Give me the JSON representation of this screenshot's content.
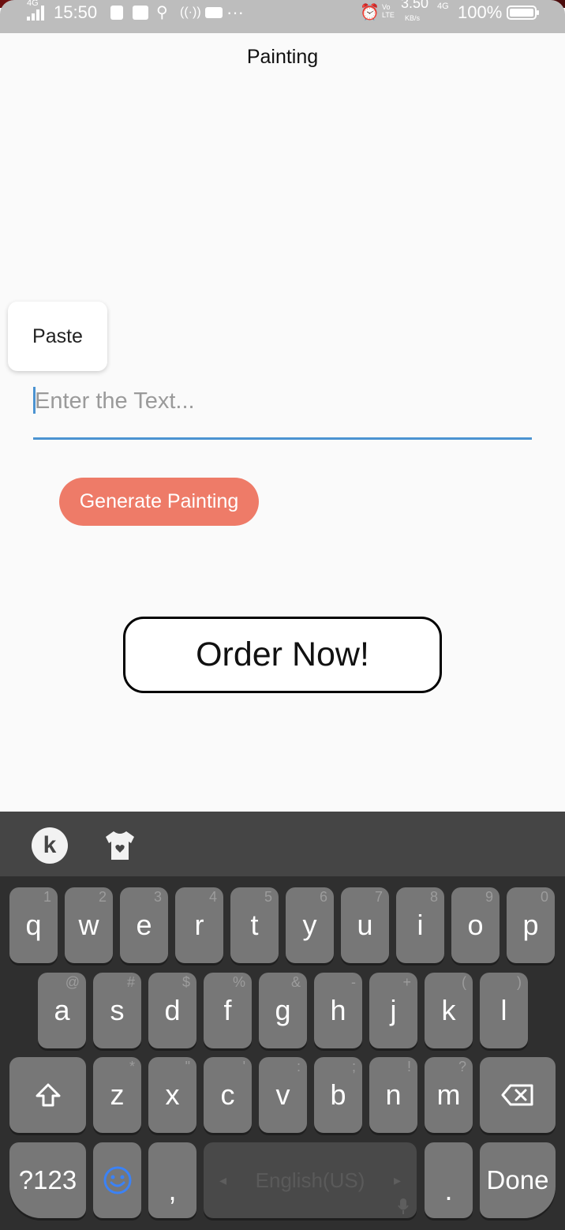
{
  "status_bar": {
    "network": "4G",
    "time": "15:50",
    "speed": "3.50",
    "speed_unit": "KB/s",
    "network2": "4G",
    "battery": "100%",
    "more": "···"
  },
  "app": {
    "title": "Painting"
  },
  "context_menu": {
    "paste_label": "Paste"
  },
  "input": {
    "placeholder": "Enter the Text...",
    "value": ""
  },
  "buttons": {
    "generate": "Generate Painting",
    "order": "Order Now!"
  },
  "keyboard": {
    "logo": "k",
    "row1": [
      {
        "label": "q",
        "hint": "1"
      },
      {
        "label": "w",
        "hint": "2"
      },
      {
        "label": "e",
        "hint": "3"
      },
      {
        "label": "r",
        "hint": "4"
      },
      {
        "label": "t",
        "hint": "5"
      },
      {
        "label": "y",
        "hint": "6"
      },
      {
        "label": "u",
        "hint": "7"
      },
      {
        "label": "i",
        "hint": "8"
      },
      {
        "label": "o",
        "hint": "9"
      },
      {
        "label": "p",
        "hint": "0"
      }
    ],
    "row2": [
      {
        "label": "a",
        "hint": "@"
      },
      {
        "label": "s",
        "hint": "#"
      },
      {
        "label": "d",
        "hint": "$"
      },
      {
        "label": "f",
        "hint": "%"
      },
      {
        "label": "g",
        "hint": "&"
      },
      {
        "label": "h",
        "hint": "-"
      },
      {
        "label": "j",
        "hint": "+"
      },
      {
        "label": "k",
        "hint": "("
      },
      {
        "label": "l",
        "hint": ")"
      }
    ],
    "row3": [
      {
        "label": "z",
        "hint": "*"
      },
      {
        "label": "x",
        "hint": "\""
      },
      {
        "label": "c",
        "hint": "'"
      },
      {
        "label": "v",
        "hint": ":"
      },
      {
        "label": "b",
        "hint": ";"
      },
      {
        "label": "n",
        "hint": "!"
      },
      {
        "label": "m",
        "hint": "?"
      }
    ],
    "symbols_key": "?123",
    "comma_key": ",",
    "period_key": ".",
    "done_key": "Done",
    "space_label": "English(US)",
    "colors": {
      "background": "#2f2f2f",
      "toolbar": "#454545",
      "key": "#777777",
      "accent_emoji": "#3b82f6"
    }
  },
  "colors": {
    "generate_button": "#ee7b68",
    "input_underline": "#4b93d1",
    "status_bar": "#bdbdbd"
  }
}
